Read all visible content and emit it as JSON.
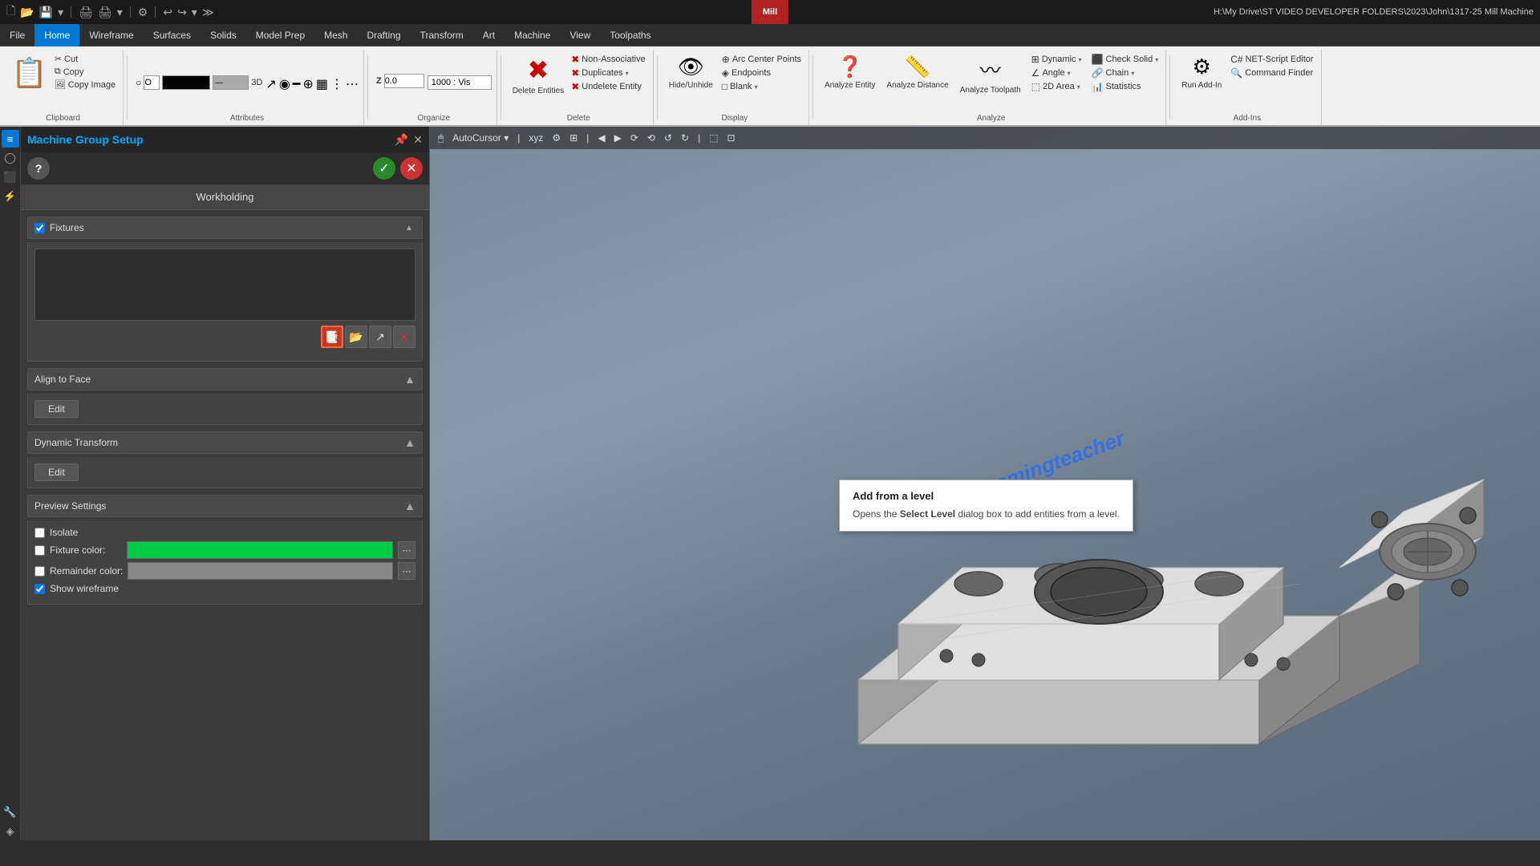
{
  "titlebar": {
    "title": "H:\\My Drive\\ST VIDEO DEVELOPER FOLDERS\\2023\\John\\1317-25 Mill Machine",
    "badge": "Mill"
  },
  "menu": {
    "items": [
      "File",
      "Home",
      "Wireframe",
      "Surfaces",
      "Solids",
      "Model Prep",
      "Mesh",
      "Drafting",
      "Transform",
      "Art",
      "Machine",
      "View",
      "Toolpaths"
    ],
    "active": "Home"
  },
  "toolbar": {
    "z_label": "Z",
    "z_value": "0.0",
    "view_3d": "3D",
    "speed": "1000 : Vis"
  },
  "ribbon": {
    "groups": {
      "clipboard": {
        "label": "Clipboard",
        "paste": "Paste",
        "cut": "Cut",
        "copy": "Copy",
        "copy_image": "Copy Image"
      },
      "attributes": {
        "label": "Attributes"
      },
      "organize": {
        "label": "Organize"
      },
      "delete": {
        "label": "Delete",
        "delete_entities": "Delete Entities",
        "non_associative": "Non-Associative",
        "duplicates": "Duplicates",
        "undelete_entity": "Undelete Entity"
      },
      "display": {
        "label": "Display",
        "hide_unhide": "Hide/Unhide",
        "arc_center_points": "Arc Center Points",
        "endpoints": "Endpoints",
        "blank": "Blank"
      },
      "analyze": {
        "label": "Analyze",
        "analyze_entity": "Analyze Entity",
        "analyze_distance": "Analyze Distance",
        "analyze_toolpath": "Analyze Toolpath",
        "dynamic": "Dynamic",
        "angle": "Angle",
        "2d_area": "2D Area",
        "chain": "Chain",
        "statistics": "Statistics",
        "check_solid": "Check Solid"
      },
      "addins": {
        "label": "Add-Ins",
        "run_addin": "Run Add-In",
        "net_script": "NET-Script Editor",
        "command_finder": "Command Finder"
      }
    }
  },
  "panel": {
    "title": "Machine Group Setup",
    "subtitle": "Workholding",
    "sections": {
      "fixtures": {
        "label": "Fixtures",
        "checked": true
      },
      "align_to_face": {
        "label": "Align to Face"
      },
      "dynamic_transform": {
        "label": "Dynamic Transform"
      },
      "preview_settings": {
        "label": "Preview Settings"
      }
    },
    "buttons": {
      "edit": "Edit",
      "ok_title": "OK",
      "cancel_title": "Cancel"
    },
    "fixture_buttons": {
      "add_level": "Add from level",
      "add_file": "Add from file",
      "transform": "Transform",
      "delete": "Delete"
    },
    "preview": {
      "isolate_label": "Isolate",
      "isolate_checked": false,
      "fixture_color_label": "Fixture color:",
      "fixture_color": "#00cc44",
      "remainder_color_label": "Remainder color:",
      "remainder_color": "#888888",
      "show_wireframe_label": "Show wireframe",
      "show_wireframe_checked": true
    }
  },
  "tooltip": {
    "title": "Add from a level",
    "text": "Opens the Select Level dialog box to add entities from a level.",
    "bold_word": "Select Level"
  },
  "viewport": {
    "watermark": "streamingteacher"
  },
  "icons": {
    "paste": "📋",
    "cut": "✂",
    "copy": "⧉",
    "undo": "↩",
    "redo": "↪",
    "new": "📄",
    "open": "📂",
    "save": "💾",
    "print": "🖨",
    "gear": "⚙",
    "search": "🔍",
    "question": "?",
    "checkmark": "✓",
    "times": "✕",
    "chevron_up": "▲",
    "chevron_down": "▼",
    "eye": "👁",
    "analyze": "📐",
    "statistics": "📊",
    "chain": "🔗",
    "solid": "⬛",
    "plus": "+",
    "minus": "−",
    "edit_pencil": "✏"
  }
}
